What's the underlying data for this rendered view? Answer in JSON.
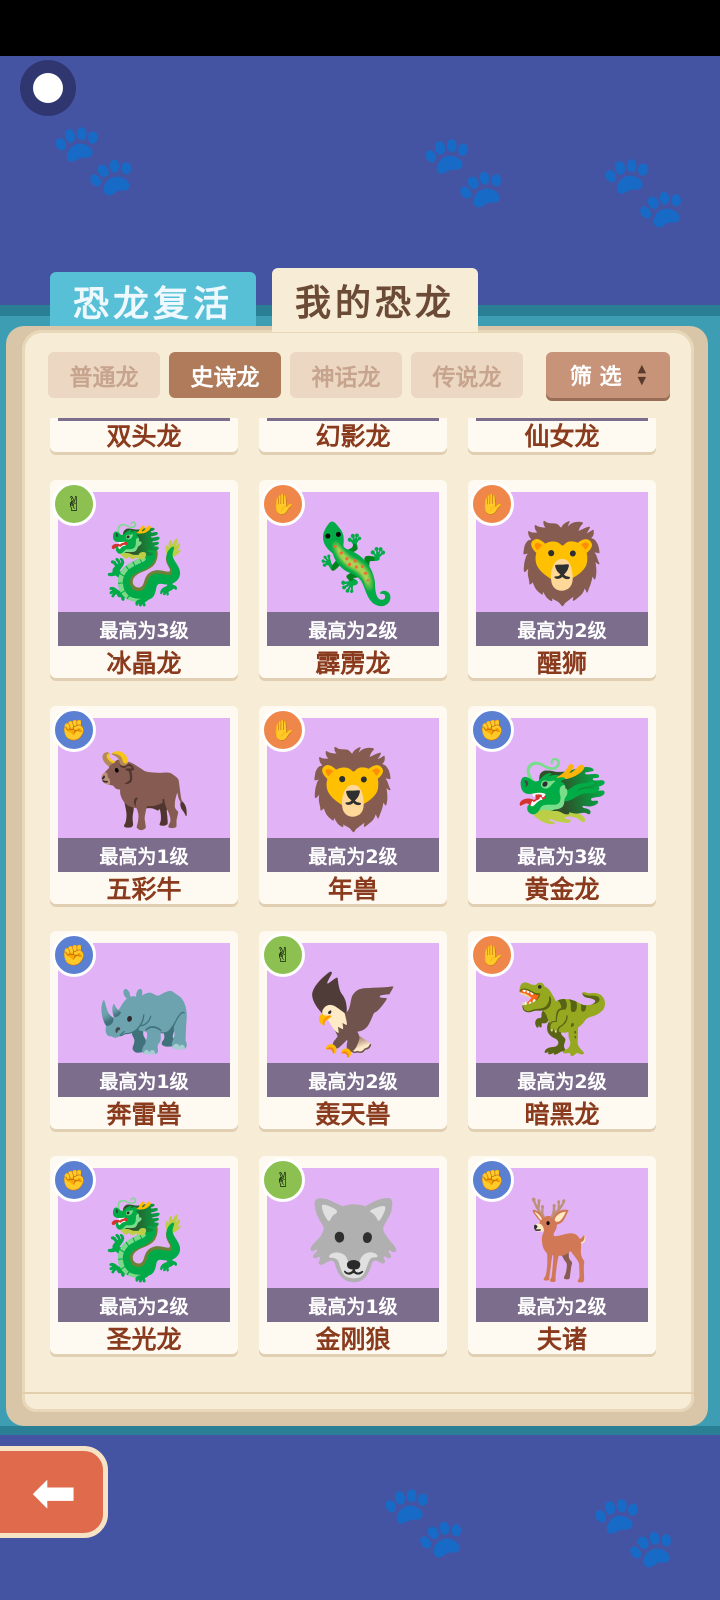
{
  "tabs": [
    {
      "label": "恐龙复活"
    },
    {
      "label": "我的恐龙"
    }
  ],
  "filters": [
    {
      "label": "普通龙",
      "active": false
    },
    {
      "label": "史诗龙",
      "active": true
    },
    {
      "label": "神话龙",
      "active": false
    },
    {
      "label": "传说龙",
      "active": false
    }
  ],
  "screen_label": "筛 选",
  "top_row": [
    {
      "name": "双头龙"
    },
    {
      "name": "幻影龙"
    },
    {
      "name": "仙女龙"
    }
  ],
  "dinos": [
    {
      "name": "冰晶龙",
      "level": "最高为3级",
      "badge": "scissors",
      "icon": "🐉"
    },
    {
      "name": "霹雳龙",
      "level": "最高为2级",
      "badge": "paper",
      "icon": "🦎"
    },
    {
      "name": "醒狮",
      "level": "最高为2级",
      "badge": "paper",
      "icon": "🦁"
    },
    {
      "name": "五彩牛",
      "level": "最高为1级",
      "badge": "rock",
      "icon": "🐂"
    },
    {
      "name": "年兽",
      "level": "最高为2级",
      "badge": "paper",
      "icon": "🦁"
    },
    {
      "name": "黄金龙",
      "level": "最高为3级",
      "badge": "rock",
      "icon": "🐲"
    },
    {
      "name": "奔雷兽",
      "level": "最高为1级",
      "badge": "rock",
      "icon": "🦏"
    },
    {
      "name": "轰天兽",
      "level": "最高为2级",
      "badge": "scissors",
      "icon": "🦅"
    },
    {
      "name": "暗黑龙",
      "level": "最高为2级",
      "badge": "paper",
      "icon": "🦖"
    },
    {
      "name": "圣光龙",
      "level": "最高为2级",
      "badge": "rock",
      "icon": "🐉"
    },
    {
      "name": "金刚狼",
      "level": "最高为1级",
      "badge": "scissors",
      "icon": "🐺"
    },
    {
      "name": "夫诸",
      "level": "最高为2级",
      "badge": "rock",
      "icon": "🦌"
    }
  ],
  "badge_glyphs": {
    "scissors": "✌",
    "paper": "✋",
    "rock": "✊"
  },
  "colors": {
    "background": "#4553a3",
    "card_image": "#e1b3f6",
    "active_filter": "#b07b5a",
    "name_text": "#8a3b1e"
  }
}
